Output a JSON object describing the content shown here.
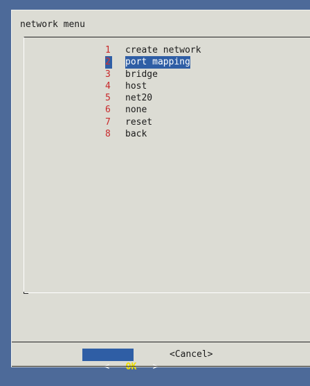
{
  "dialog": {
    "title": "network menu"
  },
  "menu": {
    "selected_index": 1,
    "items": [
      {
        "number": "1",
        "label": "create network"
      },
      {
        "number": "2",
        "label": "port mapping"
      },
      {
        "number": "3",
        "label": "bridge"
      },
      {
        "number": "4",
        "label": "host"
      },
      {
        "number": "5",
        "label": "net20"
      },
      {
        "number": "6",
        "label": "none"
      },
      {
        "number": "7",
        "label": "reset"
      },
      {
        "number": "8",
        "label": "back"
      }
    ]
  },
  "buttons": {
    "ok_left_bracket": "<",
    "ok_label": "OK",
    "ok_right_bracket": ">",
    "cancel_label": "<Cancel>"
  },
  "colors": {
    "background": "#4d6a99",
    "dialog": "#dcdcd4",
    "highlight": "#2f5ea5",
    "number": "#c8282a",
    "ok_text": "#f0e000"
  }
}
